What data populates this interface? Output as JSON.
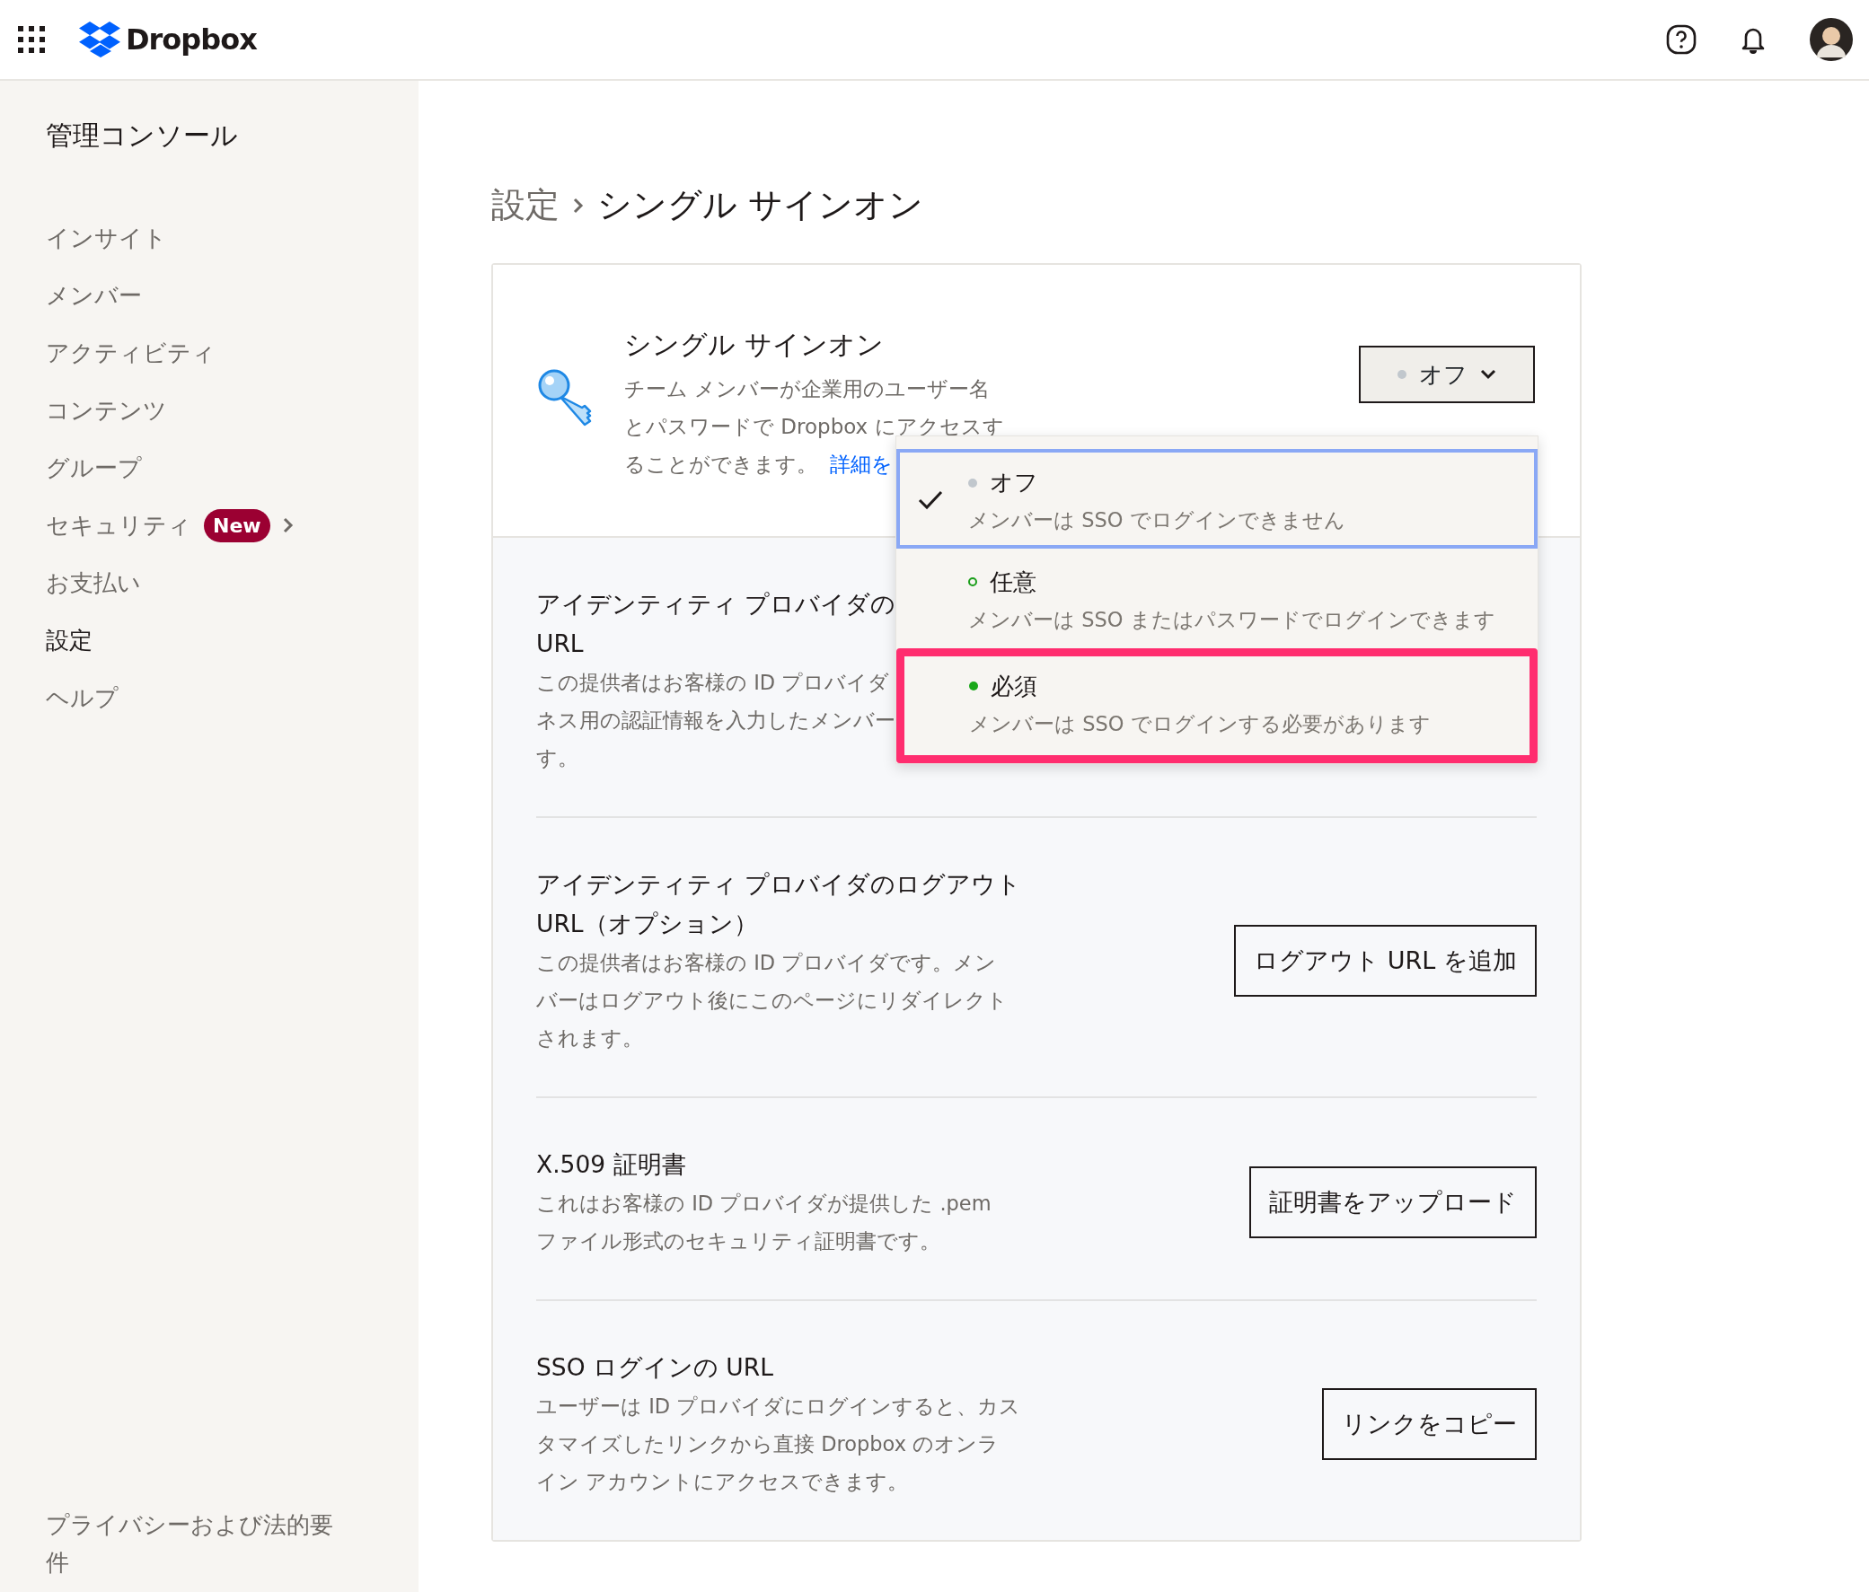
{
  "header": {
    "brand": "Dropbox"
  },
  "sidebar": {
    "title": "管理コンソール",
    "items": [
      {
        "label": "インサイト",
        "selected": false
      },
      {
        "label": "メンバー",
        "selected": false
      },
      {
        "label": "アクティビティ",
        "selected": false
      },
      {
        "label": "コンテンツ",
        "selected": false
      },
      {
        "label": "グループ",
        "selected": false
      },
      {
        "label": "セキュリティ",
        "selected": false,
        "badge": "New",
        "expandable": true
      },
      {
        "label": "お支払い",
        "selected": false
      },
      {
        "label": "設定",
        "selected": true
      },
      {
        "label": "ヘルプ",
        "selected": false
      }
    ],
    "footer_lines": [
      "プライバシーおよび法的要",
      "件"
    ]
  },
  "breadcrumb": {
    "parent": "設定",
    "current": "シングル サインオン"
  },
  "sso": {
    "title": "シングル サインオン",
    "description_lines": [
      "チーム メンバーが企業用のユーザー名",
      "とパスワードで Dropbox にアクセスす",
      "ることができます。"
    ],
    "link": "詳細を",
    "dropdown": {
      "value": "オフ",
      "expanded": true,
      "options": [
        {
          "label": "オフ",
          "description": "メンバーは SSO でログインできません",
          "selected": true,
          "focused": true,
          "highlighted": false,
          "kind": "filled",
          "color": "#c1c7cd"
        },
        {
          "label": "任意",
          "description": "メンバーは SSO またはパスワードでログインできます",
          "selected": false,
          "focused": false,
          "highlighted": false,
          "kind": "hollow",
          "color": "#1a9e1a"
        },
        {
          "label": "必須",
          "description": "メンバーは SSO でログインする必要があります",
          "selected": false,
          "focused": false,
          "highlighted": true,
          "kind": "filled",
          "color": "#1aa81a"
        }
      ]
    }
  },
  "settings": [
    {
      "title_lines": [
        "アイデンティティ プロバイダの",
        "URL"
      ],
      "description_lines": [
        "この提供者はお客様の ID プロバイダ",
        "ネス用の認証情報を入力したメンバー",
        "す。"
      ]
    },
    {
      "title_lines": [
        "アイデンティティ プロバイダのログアウト",
        "URL（オプション）"
      ],
      "description_lines": [
        "この提供者はお客様の ID プロバイダです。メン",
        "バーはログアウト後にこのページにリダイレクト",
        "されます。"
      ],
      "button": "ログアウト URL を追加"
    },
    {
      "title_lines": [
        "X.509 証明書"
      ],
      "description_lines": [
        "これはお客様の ID プロバイダが提供した .pem",
        "ファイル形式のセキュリティ証明書です。"
      ],
      "button": "証明書をアップロード"
    },
    {
      "title_lines": [
        "SSO ログインの URL"
      ],
      "description_lines": [
        "ユーザーは ID プロバイダにログインすると、カス",
        "タマイズしたリンクから直接 Dropbox のオンラ",
        "イン アカウントにアクセスできます。"
      ],
      "button": "リンクをコピー"
    }
  ]
}
